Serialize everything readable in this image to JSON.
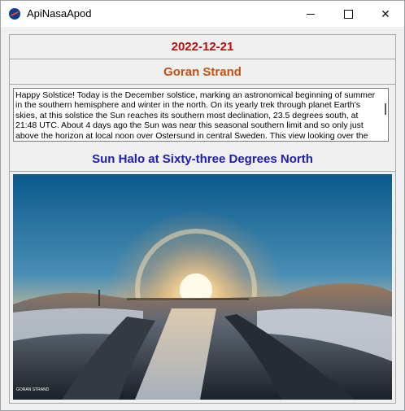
{
  "window": {
    "title": "ApiNasaApod",
    "controls": [
      "minimize",
      "maximize",
      "close"
    ]
  },
  "apod": {
    "date": "2022-12-21",
    "author": "Goran Strand",
    "explanation": "Happy Solstice! Today is the December solstice, marking an astronomical beginning of summer in the southern hemisphere and winter in the north. On its yearly trek through planet Earth's skies, at this solstice the Sun reaches its southern most declination, 23.5 degrees south, at 21:48 UTC. About 4 days ago the Sun was near this seasonal southern limit and so only just above the horizon at local noon over Ostersund in central Sweden. This view looking over the",
    "title": "Sun Halo at Sixty-three Degrees North",
    "image_credit": "GORAN STRAND"
  },
  "colors": {
    "date": "#b80d0d",
    "author": "#c4520f",
    "title": "#1d1db0"
  }
}
